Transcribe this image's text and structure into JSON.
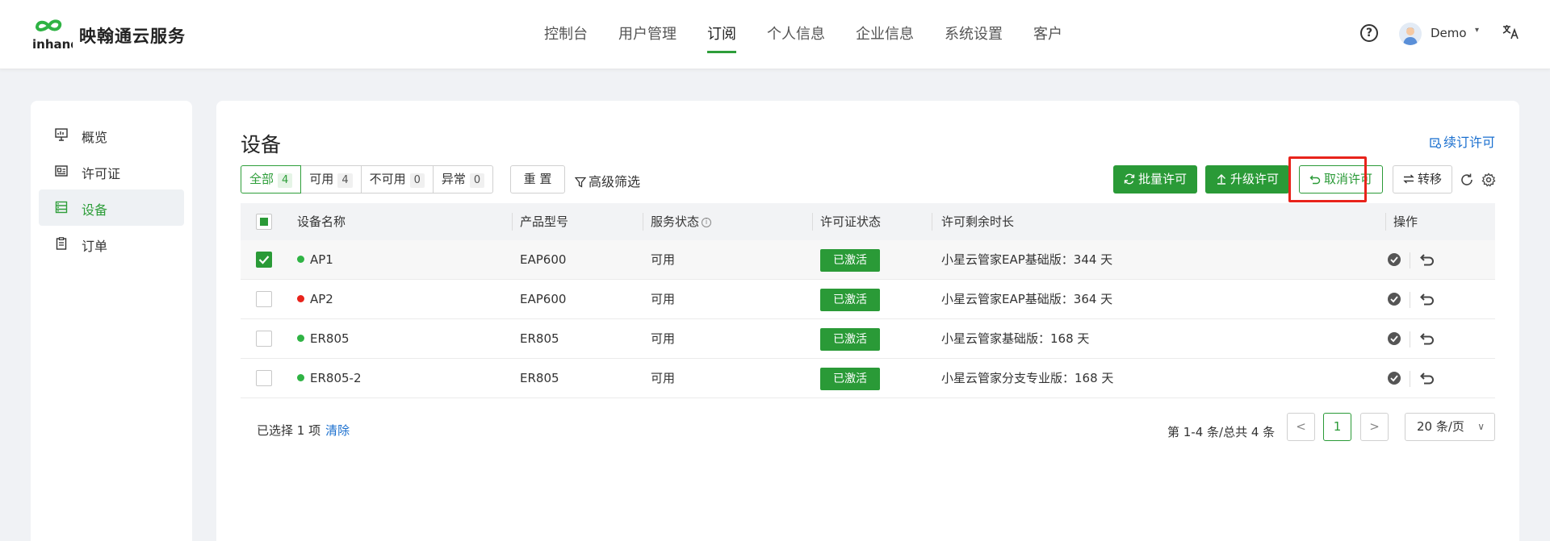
{
  "header": {
    "brand": "映翰通云服务",
    "logo_text": "inhand",
    "nav": [
      {
        "label": "控制台",
        "active": false
      },
      {
        "label": "用户管理",
        "active": false
      },
      {
        "label": "订阅",
        "active": true
      },
      {
        "label": "个人信息",
        "active": false
      },
      {
        "label": "企业信息",
        "active": false
      },
      {
        "label": "系统设置",
        "active": false
      },
      {
        "label": "客户",
        "active": false
      }
    ],
    "help_glyph": "?",
    "user_name": "Demo",
    "caret": "▾"
  },
  "sidebar": {
    "items": [
      {
        "label": "概览",
        "icon": "dashboard-icon",
        "active": false
      },
      {
        "label": "许可证",
        "icon": "license-icon",
        "active": false
      },
      {
        "label": "设备",
        "icon": "device-icon",
        "active": true
      },
      {
        "label": "订单",
        "icon": "order-icon",
        "active": false
      }
    ]
  },
  "main": {
    "title": "设备",
    "renew_link": "续订许可",
    "filters": [
      {
        "label": "全部",
        "count": "4",
        "active": true
      },
      {
        "label": "可用",
        "count": "4",
        "active": false
      },
      {
        "label": "不可用",
        "count": "0",
        "active": false
      },
      {
        "label": "异常",
        "count": "0",
        "active": false
      }
    ],
    "reset_label": "重 置",
    "advanced_filter_label": "高级筛选",
    "actions": {
      "batch_license": "批量许可",
      "upgrade_license": "升级许可",
      "cancel_license": "取消许可",
      "transfer": "转移"
    },
    "table": {
      "columns": [
        "设备名称",
        "产品型号",
        "服务状态",
        "许可证状态",
        "许可剩余时长",
        "操作"
      ],
      "rows": [
        {
          "name": "AP1",
          "model": "EAP600",
          "service": "可用",
          "license_status": "已激活",
          "remaining": "小星云管家EAP基础版：344 天",
          "online": true,
          "selected": true
        },
        {
          "name": "AP2",
          "model": "EAP600",
          "service": "可用",
          "license_status": "已激活",
          "remaining": "小星云管家EAP基础版：364 天",
          "online": false,
          "selected": false
        },
        {
          "name": "ER805",
          "model": "ER805",
          "service": "可用",
          "license_status": "已激活",
          "remaining": "小星云管家基础版：168 天",
          "online": true,
          "selected": false
        },
        {
          "name": "ER805-2",
          "model": "ER805",
          "service": "可用",
          "license_status": "已激活",
          "remaining": "小星云管家分支专业版：168 天",
          "online": true,
          "selected": false
        }
      ]
    },
    "footer": {
      "selected_text": "已选择 1 项",
      "clear_label": "清除",
      "page_info": "第 1-4 条/总共 4 条",
      "prev": "<",
      "current_page": "1",
      "next": ">",
      "page_size": "20 条/页"
    }
  },
  "colors": {
    "accent": "#2a9a37",
    "link": "#1a6fcf",
    "online": "#2fb344",
    "offline": "#e8231b",
    "highlight": "#e8231b"
  }
}
